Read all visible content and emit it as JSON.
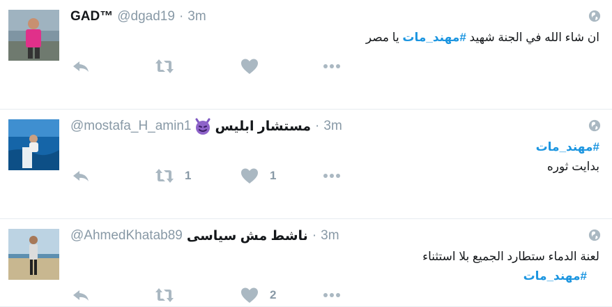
{
  "tweets": [
    {
      "name": "GAD™",
      "handle": "@dgad19",
      "time": "3m",
      "lines": [
        {
          "text": "ان شاء الله في الجنة شهيد ",
          "hashtag": "#مهند_مات",
          "after": " يا مصر"
        }
      ],
      "reply_count": "",
      "retweet_count": "",
      "like_count": ""
    },
    {
      "name": "مستشار ابليس",
      "name_emoji": "smiling-imp-emoji",
      "handle": "@mostafa_H_amin1",
      "time": "3m",
      "lines": [
        {
          "text": "",
          "hashtag": "#مهند_مات",
          "after": ""
        },
        {
          "text": "بدايت ثوره",
          "hashtag": "",
          "after": ""
        }
      ],
      "reply_count": "",
      "retweet_count": "1",
      "like_count": "1"
    },
    {
      "name": "ناشط مش سياسى",
      "handle": "@AhmedKhatab89",
      "time": "3m",
      "lines": [
        {
          "text": "لعنة الدماء ستطارد الجميع بلا استثناء",
          "hashtag": "",
          "after": ""
        },
        {
          "text": "",
          "hashtag": "#مهند_مات",
          "after": ""
        }
      ],
      "reply_count": "",
      "retweet_count": "",
      "like_count": "2"
    }
  ],
  "separator": "·",
  "colors": {
    "accent": "#1b95e0",
    "muted": "#8899a6",
    "icon": "#aab8c2",
    "divider": "#e6ecf0"
  },
  "icons": [
    "reply-icon",
    "retweet-icon",
    "like-icon",
    "more-icon",
    "globe-icon",
    "smiling-imp-emoji"
  ]
}
